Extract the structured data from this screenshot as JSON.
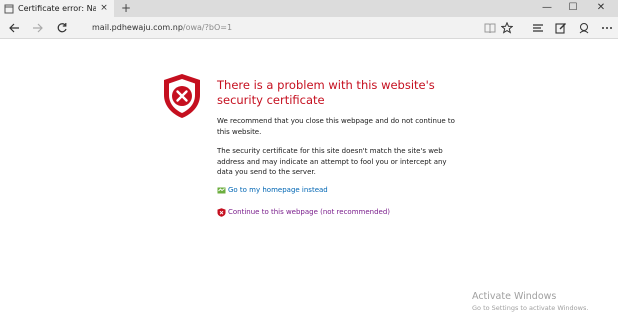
{
  "tab": {
    "title": "Certificate error: Navigal",
    "close_glyph": "×"
  },
  "new_tab_glyph": "+",
  "window_controls": {
    "minimize": "—",
    "maximize": "☐",
    "close": "✕"
  },
  "address_bar": {
    "url_host": "mail.pdhewaju.com.np",
    "url_path": "/owa/?bO=1"
  },
  "toolbar_icons": [
    "back-icon",
    "forward-icon",
    "refresh-icon",
    "reading-view-icon",
    "favorite-star-icon",
    "hub-icon",
    "web-note-icon",
    "share-icon",
    "more-icon"
  ],
  "error": {
    "title": "There is a problem with this website's security certificate",
    "recommend": "We recommend that you close this webpage and do not continue to this website.",
    "details": "The security certificate for this site doesn't match the site's web address and may indicate an attempt to fool you or intercept any data you send to the server.",
    "home_link": "Go to my homepage instead",
    "continue_link": "Continue to this webpage (not recommended)"
  },
  "watermark": {
    "title": "Activate Windows",
    "subtitle": "Go to Settings to activate Windows."
  },
  "colors": {
    "error_red": "#c50f1f",
    "link_blue": "#0066b4",
    "link_purple": "#7a1e8c"
  }
}
